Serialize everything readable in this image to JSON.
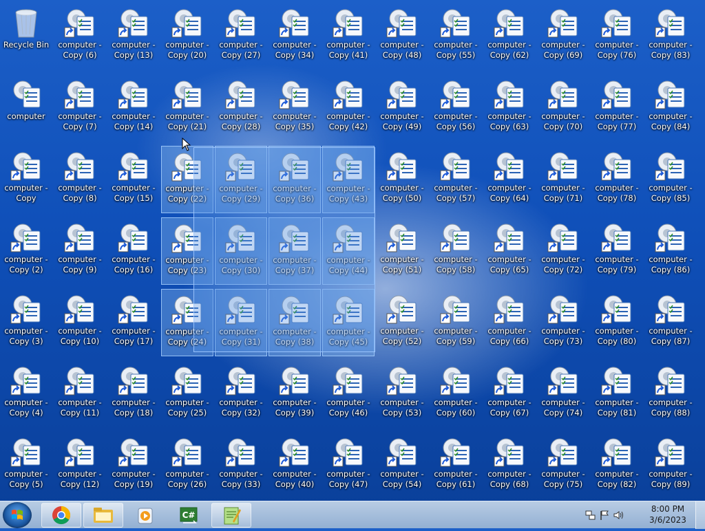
{
  "desktop": {
    "recycle_bin": {
      "line1": "Recycle Bin",
      "line2": ""
    },
    "columns": [
      [
        {
          "line1": "computer -",
          "line2": "Copy (6)"
        },
        {
          "line1": "computer -",
          "line2": "Copy (7)"
        },
        {
          "line1": "computer -",
          "line2": "Copy (8)"
        },
        {
          "line1": "computer -",
          "line2": "Copy (9)"
        },
        {
          "line1": "computer -",
          "line2": "Copy (10)"
        },
        {
          "line1": "computer -",
          "line2": "Copy (11)"
        },
        {
          "line1": "computer -",
          "line2": "Copy (12)"
        }
      ]
    ],
    "grid_labels": [
      [
        "Recycle Bin|",
        "computer -|Copy (6)",
        "computer -|Copy (13)",
        "computer -|Copy (20)",
        "computer -|Copy (27)",
        "computer -|Copy (34)",
        "computer -|Copy (41)",
        "computer -|Copy (48)",
        "computer -|Copy (55)",
        "computer -|Copy (62)",
        "computer -|Copy (69)",
        "computer -|Copy (76)",
        "computer -|Copy (83)"
      ],
      [
        "computer|",
        "computer -|Copy (7)",
        "computer -|Copy (14)",
        "computer -|Copy (21)",
        "computer -|Copy (28)",
        "computer -|Copy (35)",
        "computer -|Copy (42)",
        "computer -|Copy (49)",
        "computer -|Copy (56)",
        "computer -|Copy (63)",
        "computer -|Copy (70)",
        "computer -|Copy (77)",
        "computer -|Copy (84)"
      ],
      [
        "computer -|Copy",
        "computer -|Copy (8)",
        "computer -|Copy (15)",
        "computer -|Copy (22)",
        "computer -|Copy (29)",
        "computer -|Copy (36)",
        "computer -|Copy (43)",
        "computer -|Copy (50)",
        "computer -|Copy (57)",
        "computer -|Copy (64)",
        "computer -|Copy (71)",
        "computer -|Copy (78)",
        "computer -|Copy (85)"
      ],
      [
        "computer -|Copy (2)",
        "computer -|Copy (9)",
        "computer -|Copy (16)",
        "computer -|Copy (23)",
        "computer -|Copy (30)",
        "computer -|Copy (37)",
        "computer -|Copy (44)",
        "computer -|Copy (51)",
        "computer -|Copy (58)",
        "computer -|Copy (65)",
        "computer -|Copy (72)",
        "computer -|Copy (79)",
        "computer -|Copy (86)"
      ],
      [
        "computer -|Copy (3)",
        "computer -|Copy (10)",
        "computer -|Copy (17)",
        "computer -|Copy (24)",
        "computer -|Copy (31)",
        "computer -|Copy (38)",
        "computer -|Copy (45)",
        "computer -|Copy (52)",
        "computer -|Copy (59)",
        "computer -|Copy (66)",
        "computer -|Copy (73)",
        "computer -|Copy (80)",
        "computer -|Copy (87)"
      ],
      [
        "computer -|Copy (4)",
        "computer -|Copy (11)",
        "computer -|Copy (18)",
        "computer -|Copy (25)",
        "computer -|Copy (32)",
        "computer -|Copy (39)",
        "computer -|Copy (46)",
        "computer -|Copy (53)",
        "computer -|Copy (60)",
        "computer -|Copy (67)",
        "computer -|Copy (74)",
        "computer -|Copy (81)",
        "computer -|Copy (88)"
      ],
      [
        "computer -|Copy (5)",
        "computer -|Copy (12)",
        "computer -|Copy (19)",
        "computer -|Copy (26)",
        "computer -|Copy (33)",
        "computer -|Copy (40)",
        "computer -|Copy (47)",
        "computer -|Copy (54)",
        "computer -|Copy (61)",
        "computer -|Copy (68)",
        "computer -|Copy (75)",
        "computer -|Copy (82)",
        "computer -|Copy (89)"
      ]
    ],
    "selected_labels": [
      "Copy (22)",
      "Copy (29)",
      "Copy (36)",
      "Copy (43)",
      "Copy (23)",
      "Copy (30)",
      "Copy (37)",
      "Copy (44)",
      "Copy (24)",
      "Copy (31)",
      "Copy (38)",
      "Copy (45)"
    ],
    "icon_name": "settings-shortcut-icon",
    "colors": {
      "desktop_blue": "#1c5fc8",
      "label_text": "#ffffff",
      "selection": "#5a96e6"
    }
  },
  "taskbar": {
    "start_button": "start-orb-icon",
    "pinned": [
      "chrome-icon",
      "file-explorer-icon",
      "media-player-icon",
      "csharp-icon",
      "notepad-plus-plus-icon"
    ],
    "active_index": 4,
    "tray_icons": [
      "network-icon",
      "action-center-flag-icon",
      "volume-icon"
    ],
    "clock": {
      "time": "8:00 PM",
      "date": "3/6/2023"
    }
  }
}
